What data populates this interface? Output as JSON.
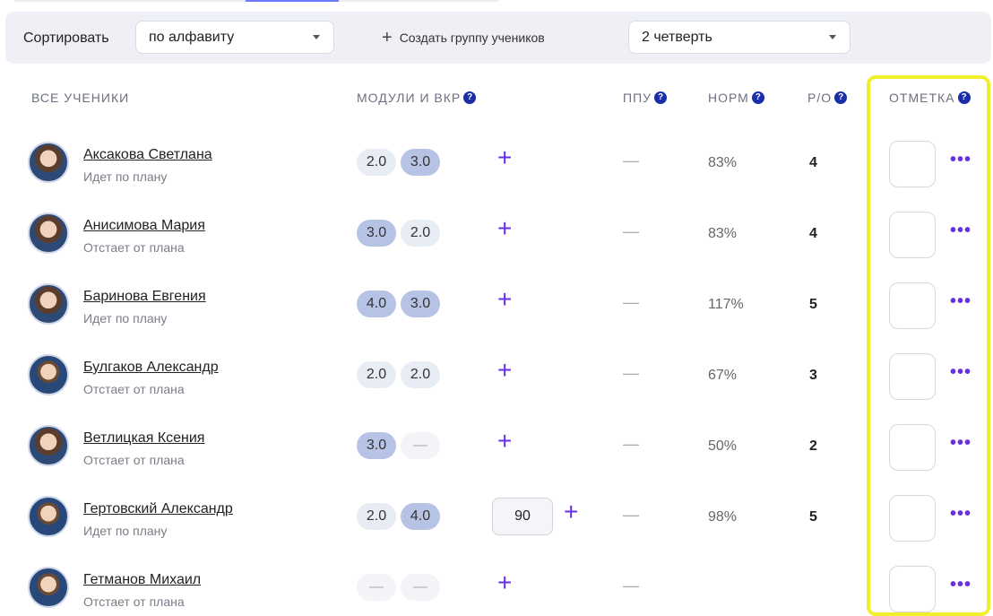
{
  "toolbar": {
    "sort_label": "Сортировать",
    "sort_value": "по алфавиту",
    "create_group_label": "Создать группу учеников",
    "quarter_value": "2 четверть"
  },
  "columns": {
    "all_students": "ВСЕ УЧЕНИКИ",
    "modules_vkr": "МОДУЛИ И ВКР",
    "ppu": "ППУ",
    "norm": "НОРМ",
    "ro": "Р/О",
    "mark": "ОТМЕТКА",
    "help_symbol": "?"
  },
  "students": [
    {
      "name": "Аксакова Светлана",
      "status": "Идет по плану",
      "m1": "2.0",
      "m2": "3.0",
      "ppu": "—",
      "norm": "83%",
      "ro": "4"
    },
    {
      "name": "Анисимова Мария",
      "status": "Отстает от плана",
      "m1": "3.0",
      "m2": "2.0",
      "ppu": "—",
      "norm": "83%",
      "ro": "4"
    },
    {
      "name": "Баринова Евгения",
      "status": "Идет по плану",
      "m1": "4.0",
      "m2": "3.0",
      "ppu": "—",
      "norm": "117%",
      "ro": "5"
    },
    {
      "name": "Булгаков Александр",
      "status": "Отстает от плана",
      "m1": "2.0",
      "m2": "2.0",
      "ppu": "—",
      "norm": "67%",
      "ro": "3"
    },
    {
      "name": "Ветлицкая Ксения",
      "status": "Отстает от плана",
      "m1": "3.0",
      "m2": "—",
      "ppu": "—",
      "norm": "50%",
      "ro": "2"
    },
    {
      "name": "Гертовский Александр",
      "status": "Идет по плану",
      "m1": "2.0",
      "m2": "4.0",
      "vkr": "90",
      "ppu": "—",
      "norm": "98%",
      "ro": "5"
    },
    {
      "name": "Гетманов Михаил",
      "status": "Отстает от плана",
      "m1": "—",
      "m2": "—",
      "ppu": "—",
      "norm": "",
      "ro": ""
    }
  ],
  "icons": {
    "plus": "+",
    "more": "•••"
  },
  "colors": {
    "accent": "#6a2ee8",
    "highlight": "#f0ef2a",
    "help_icon": "#1a2ea8"
  }
}
